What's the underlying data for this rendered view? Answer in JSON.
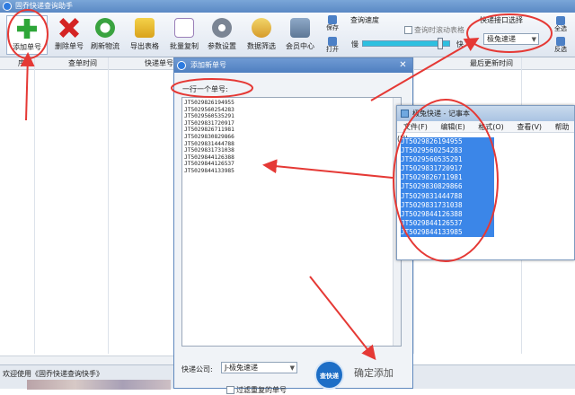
{
  "window": {
    "title": "固乔快递查询助手"
  },
  "toolbar": {
    "buttons": [
      {
        "label": "添加单号",
        "icon": "add-icon"
      },
      {
        "label": "删除单号",
        "icon": "delete-icon"
      },
      {
        "label": "刷新物流",
        "icon": "refresh-icon"
      },
      {
        "label": "导出表格",
        "icon": "export-icon"
      },
      {
        "label": "批量复制",
        "icon": "copy-icon"
      },
      {
        "label": "参数设置",
        "icon": "settings-icon"
      },
      {
        "label": "数据筛选",
        "icon": "filter-icon"
      },
      {
        "label": "会员中心",
        "icon": "member-icon"
      }
    ],
    "save_label": "保存",
    "open_label": "打开",
    "speed_title": "查询速度",
    "slow_label": "慢",
    "fast_label": "快",
    "scroll_check_label": "查询时滚动表格",
    "speed_level": 0.9,
    "interface_title": "快递接口选择",
    "interface_value": "极兔速递",
    "select_all_label": "全选",
    "invert_label": "反选"
  },
  "grid": {
    "columns": [
      "序",
      "查单时间",
      "快递单号",
      "最后更新时间",
      "最后更新时间"
    ]
  },
  "status": {
    "text": "欢迎使用《固乔快递查询快手》"
  },
  "dialog": {
    "title": "添加新单号",
    "instruction": "一行一个单号:",
    "numbers": [
      "JT5029826194955",
      "JT5029560254283",
      "JT5029560535291",
      "JT5029831720917",
      "JT5029826711981",
      "JT5029830829866",
      "JT5029831444788",
      "JT5029831731038",
      "JT5029844126388",
      "JT5029844126537",
      "JT5029844133985"
    ],
    "courier_label": "快递公司:",
    "courier_value": "J-极兔速递",
    "stamp_label": "查快递",
    "confirm_label": "确定添加",
    "filter_label": "过滤重复的单号"
  },
  "notepad": {
    "title": "极兔快递 - 记事本",
    "menu": [
      "文件(F)",
      "编辑(E)",
      "格式(O)",
      "查看(V)",
      "帮助(H)"
    ],
    "lines": [
      "JT5029826194955",
      "JT5029560254283",
      "JT5029560535291",
      "JT5029831720917",
      "JT5029826711981",
      "JT5029830829866",
      "JT5029831444788",
      "JT5029831731038",
      "JT5029844126388",
      "JT5029844126537",
      "JT5029844133985"
    ]
  },
  "annotation_color": "#e53935"
}
